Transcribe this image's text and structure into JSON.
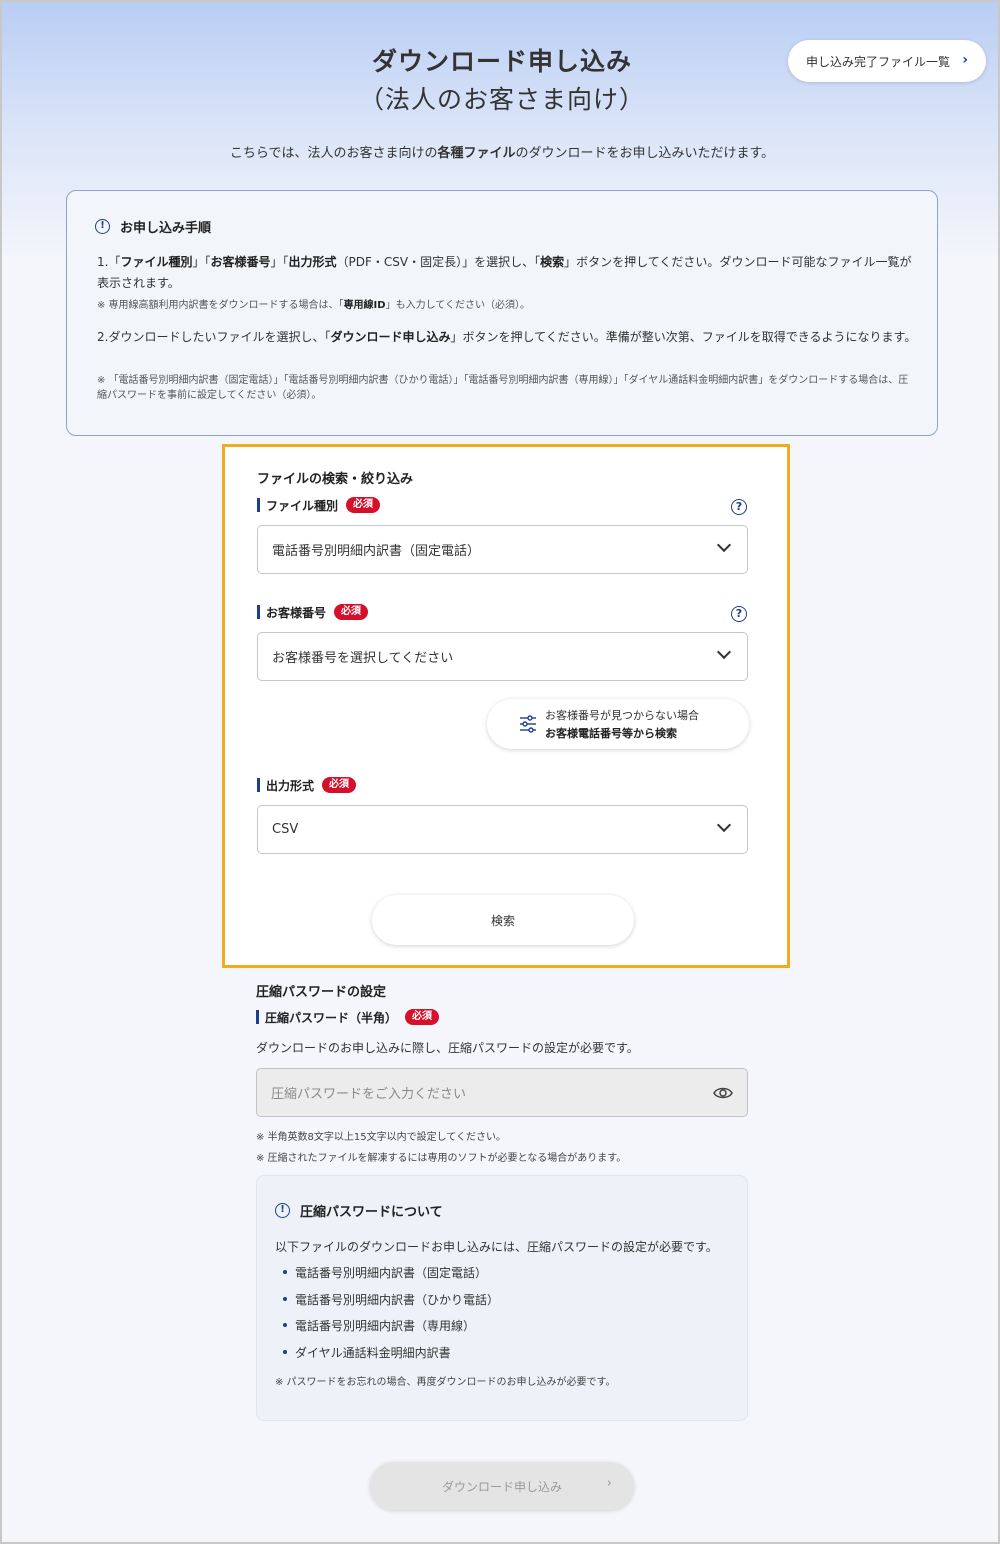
{
  "header": {
    "title_line1": "ダウンロード申し込み",
    "title_line2": "（法人のお客さま向け）",
    "list_button_label": "申し込み完了ファイル一覧",
    "chevron": "›"
  },
  "intro": {
    "before": "こちらでは、法人のお客さま向けの",
    "bold": "各種ファイル",
    "after": "のダウンロードをお申し込みいただけます。"
  },
  "steps": {
    "heading": "お申し込み手順",
    "step1": {
      "num": "1.",
      "q1": "「",
      "b1": "ファイル種別",
      "q2": "」「",
      "b2": "お客様番号",
      "q3": "」「",
      "b3": "出力形式",
      "mid": "（PDF・CSV・固定長）」を選択し、「",
      "b4": "検索",
      "tail": "」ボタンを押してください。ダウンロード可能なファイル一覧が表示されます。"
    },
    "note1": {
      "before": "※ 専用線高額利用内訳書をダウンロードする場合は、「",
      "bold": "専用線ID",
      "after": "」も入力してください（必須）。"
    },
    "step2": {
      "num": "2.",
      "before": "ダウンロードしたいファイルを選択し、「",
      "bold": "ダウンロード申し込み",
      "after": "」ボタンを押してください。準備が整い次第、ファイルを取得できるようになります。"
    },
    "note2": "※ 「電話番号別明細内訳書（固定電話）」「電話番号別明細内訳書（ひかり電話）」「電話番号別明細内訳書（専用線）」「ダイヤル通話料金明細内訳書」をダウンロードする場合は、圧縮パスワードを事前に設定してください（必須）。"
  },
  "search": {
    "section_title": "ファイルの検索・絞り込み",
    "required_badge": "必須",
    "file_type_label": "ファイル種別",
    "file_type_value": "電話番号別明細内訳書（固定電話）",
    "customer_label": "お客様番号",
    "customer_value": "お客様番号を選択してください",
    "not_found_line1": "お客様番号が見つからない場合",
    "not_found_line2": "お客様電話番号等から検索",
    "format_label": "出力形式",
    "format_value": "CSV",
    "search_button": "検索",
    "help_glyph": "?"
  },
  "password": {
    "section_title": "圧縮パスワードの設定",
    "label": "圧縮パスワード（半角）",
    "description": "ダウンロードのお申し込みに際し、圧縮パスワードの設定が必要です。",
    "placeholder": "圧縮パスワードをご入力ください",
    "note1": "※ 半角英数8文字以上15文字以内で設定してください。",
    "note2": "※ 圧縮されたファイルを解凍するには専用のソフトが必要となる場合があります。",
    "about_heading": "圧縮パスワードについて",
    "about_desc": "以下ファイルのダウンロードお申し込みには、圧縮パスワードの設定が必要です。",
    "files": [
      "電話番号別明細内訳書（固定電話）",
      "電話番号別明細内訳書（ひかり電話）",
      "電話番号別明細内訳書（専用線）",
      "ダイヤル通話料金明細内訳書"
    ],
    "about_foot": "※ パスワードをお忘れの場合、再度ダウンロードのお申し込みが必要です。"
  },
  "final_button": "ダウンロード申し込み",
  "colors": {
    "accent": "#1d3d8f",
    "required": "#d6102a",
    "highlight_border": "#f0ac1c"
  },
  "icons": [
    "info-icon",
    "help-icon",
    "chevron-right-icon",
    "chevron-down-icon",
    "filter-sliders-icon",
    "eye-icon"
  ]
}
